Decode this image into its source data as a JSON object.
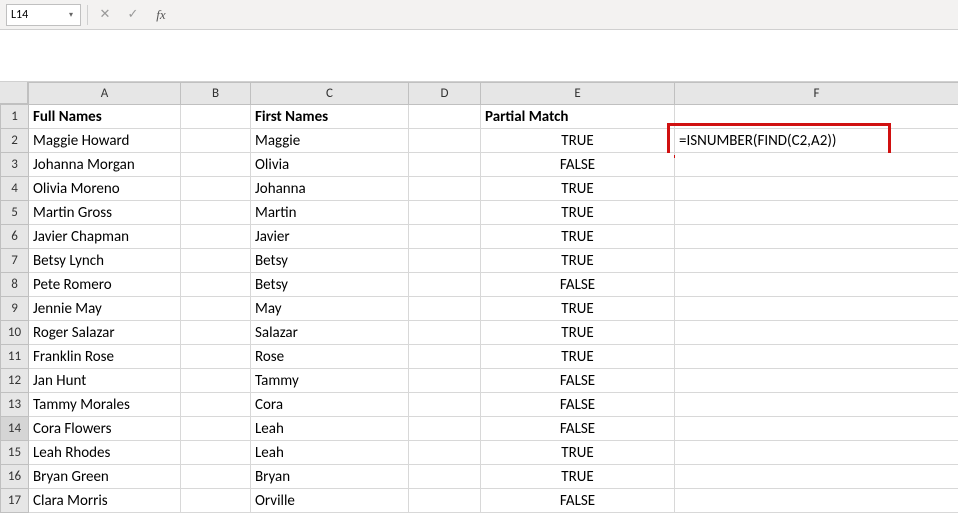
{
  "nameBox": {
    "value": "L14"
  },
  "formulaBar": {
    "value": ""
  },
  "columns": [
    "A",
    "B",
    "C",
    "D",
    "E",
    "F"
  ],
  "headerRow": {
    "A": "Full Names",
    "C": "First Names",
    "E": "Partial Match"
  },
  "highlightCell": {
    "value": "=ISNUMBER(FIND(C2,A2))"
  },
  "rows": [
    {
      "n": 2,
      "A": "Maggie Howard",
      "C": "Maggie",
      "E": "TRUE"
    },
    {
      "n": 3,
      "A": "Johanna Morgan",
      "C": "Olivia",
      "E": "FALSE"
    },
    {
      "n": 4,
      "A": "Olivia Moreno",
      "C": "Johanna",
      "E": "TRUE"
    },
    {
      "n": 5,
      "A": "Martin Gross",
      "C": "Martin",
      "E": "TRUE"
    },
    {
      "n": 6,
      "A": "Javier Chapman",
      "C": "Javier",
      "E": "TRUE"
    },
    {
      "n": 7,
      "A": "Betsy Lynch",
      "C": "Betsy",
      "E": "TRUE"
    },
    {
      "n": 8,
      "A": "Pete Romero",
      "C": "Betsy",
      "E": "FALSE"
    },
    {
      "n": 9,
      "A": "Jennie May",
      "C": "May",
      "E": "TRUE"
    },
    {
      "n": 10,
      "A": "Roger Salazar",
      "C": "Salazar",
      "E": "TRUE"
    },
    {
      "n": 11,
      "A": "Franklin Rose",
      "C": "Rose",
      "E": "TRUE"
    },
    {
      "n": 12,
      "A": "Jan Hunt",
      "C": "Tammy",
      "E": "FALSE"
    },
    {
      "n": 13,
      "A": "Tammy Morales",
      "C": "Cora",
      "E": "FALSE"
    },
    {
      "n": 14,
      "A": "Cora Flowers",
      "C": "Leah",
      "E": "FALSE"
    },
    {
      "n": 15,
      "A": "Leah Rhodes",
      "C": "Leah",
      "E": "TRUE"
    },
    {
      "n": 16,
      "A": "Bryan Green",
      "C": "Bryan",
      "E": "TRUE"
    },
    {
      "n": 17,
      "A": "Clara Morris",
      "C": "Orville",
      "E": "FALSE"
    }
  ],
  "icons": {
    "cancel": "✕",
    "confirm": "✓",
    "fx": "fx",
    "caret": "▾"
  }
}
